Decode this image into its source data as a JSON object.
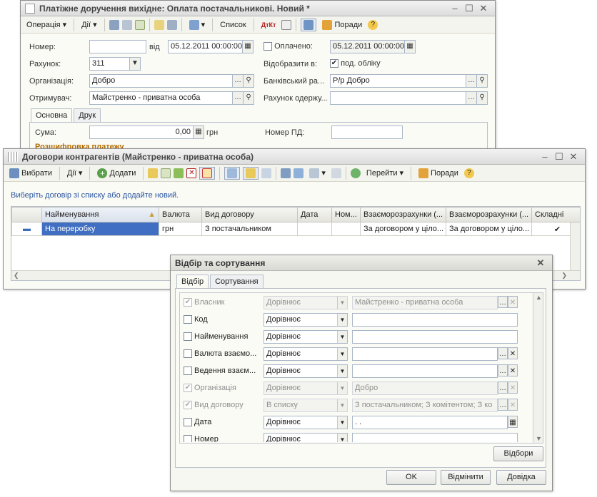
{
  "win1": {
    "title": "Платіжне доручення вихідне: Оплата постачальникові. Новий *",
    "toolbar": {
      "operation": "Операція",
      "actions": "Дії",
      "list": "Список",
      "tips": "Поради",
      "dtkt": "ДтКт"
    },
    "form": {
      "number_label": "Номер:",
      "number_value": "",
      "from_label": "від",
      "date_value": "05.12.2011 00:00:00",
      "paid_label": "Оплачено:",
      "paid_date": "05.12.2011 00:00:00",
      "account_label": "Рахунок:",
      "account_value": "311",
      "reflect_label": "Відобразити в:",
      "reflect_value": "под. обліку",
      "org_label": "Організація:",
      "org_value": "Добро",
      "bank_label": "Банківський ра...",
      "bank_value": "Р/р Добро",
      "recipient_label": "Отримувач:",
      "recipient_value": "Майстренко - приватна особа",
      "recipient_acc_label": "Рахунок одержу...",
      "recipient_acc_value": "",
      "tab_main": "Основна",
      "tab_print": "Друк",
      "sum_label": "Сума:",
      "sum_value": "0,00",
      "currency": "грн",
      "tax_label": "Номер ПД:",
      "tax_value": "",
      "breakdown": "Розшифровка платежу"
    }
  },
  "win2": {
    "title": "Договори контрагентів (Майстренко - приватна особа)",
    "toolbar": {
      "select": "Вибрати",
      "actions": "Дії",
      "add": "Додати",
      "goto": "Перейти",
      "tips": "Поради"
    },
    "hint": "Виберіть договір зі списку або додайте новий.",
    "columns": [
      "Найменування",
      "Валюта",
      "Вид договору",
      "Дата",
      "Ном...",
      "Взаєморозрахунки (...",
      "Взаєморозрахунки (...",
      "Складні"
    ],
    "rows": [
      [
        "На переробку",
        "грн",
        "З постачальником",
        "",
        "",
        "За договором у ціло...",
        "За договором у ціло...",
        "✔"
      ]
    ]
  },
  "win3": {
    "title": "Відбір та сортування",
    "tab_filter": "Відбір",
    "tab_sort": "Сортування",
    "filters": [
      {
        "checked": true,
        "disabled": true,
        "name": "Власник",
        "cmp": "Дорівнює",
        "value": "Майстренко - приватна особа"
      },
      {
        "checked": false,
        "disabled": false,
        "name": "Код",
        "cmp": "Дорівнює",
        "value": ""
      },
      {
        "checked": false,
        "disabled": false,
        "name": "Найменування",
        "cmp": "Дорівнює",
        "value": ""
      },
      {
        "checked": false,
        "disabled": false,
        "name": "Валюта взаємо...",
        "cmp": "Дорівнює",
        "value": ""
      },
      {
        "checked": false,
        "disabled": false,
        "name": "Ведення взаєм...",
        "cmp": "Дорівнює",
        "value": ""
      },
      {
        "checked": true,
        "disabled": true,
        "name": "Організація",
        "cmp": "Дорівнює",
        "value": "Добро"
      },
      {
        "checked": true,
        "disabled": true,
        "name": "Вид договору",
        "cmp": "В списку",
        "value": "З постачальником; З комітентом; З ко"
      },
      {
        "checked": false,
        "disabled": false,
        "name": "Дата",
        "cmp": "Дорівнює",
        "value": " .  ."
      },
      {
        "checked": false,
        "disabled": false,
        "name": "Номер",
        "cmp": "Дорівнює",
        "value": ""
      }
    ],
    "filters_btn": "Відбори",
    "ok": "OK",
    "cancel": "Відмінити",
    "help": "Довідка"
  }
}
